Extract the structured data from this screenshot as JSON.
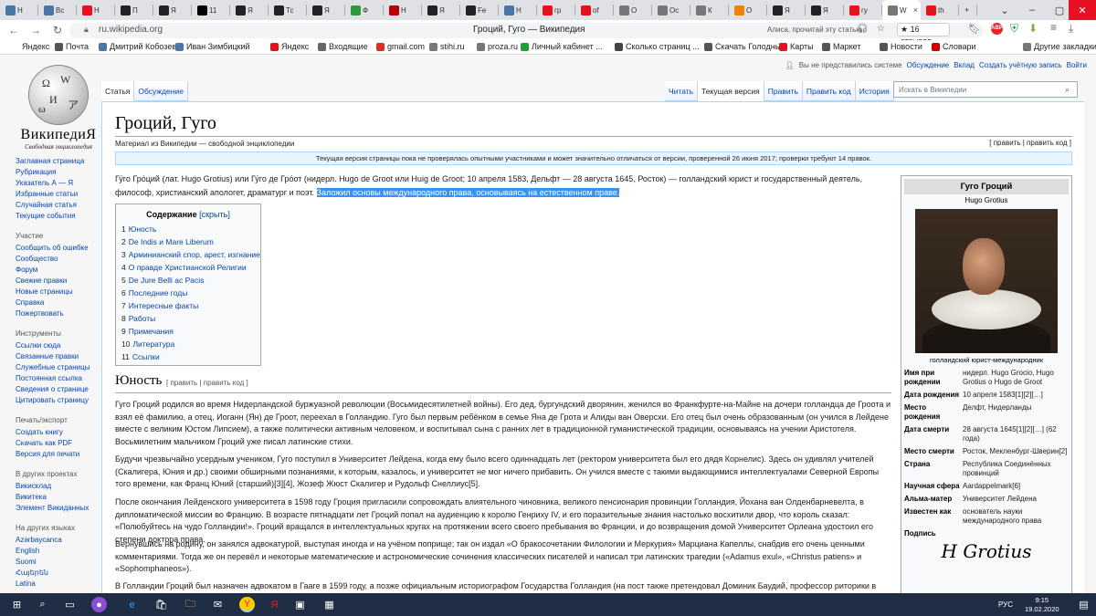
{
  "tabs": [
    {
      "icon": "vk-icon",
      "label": "Н",
      "color": "#4a76a8"
    },
    {
      "icon": "vk-icon",
      "label": "Вс",
      "color": "#4a76a8"
    },
    {
      "icon": "yandex-icon",
      "label": "Н",
      "color": "#e5121b"
    },
    {
      "icon": "zen-icon",
      "label": "П",
      "color": "#222"
    },
    {
      "icon": "zen-icon",
      "label": "Я",
      "color": "#222"
    },
    {
      "icon": "m-icon",
      "label": "11",
      "color": "#000"
    },
    {
      "icon": "zen-icon",
      "label": "Я",
      "color": "#222"
    },
    {
      "icon": "zen-icon",
      "label": "Тс",
      "color": "#222"
    },
    {
      "icon": "zen-icon",
      "label": "Я",
      "color": "#222"
    },
    {
      "icon": "f-icon",
      "label": "Ф",
      "color": "#2a9d3a"
    },
    {
      "icon": "h-icon",
      "label": "Н",
      "color": "#b00"
    },
    {
      "icon": "zen-icon",
      "label": "Я",
      "color": "#222"
    },
    {
      "icon": "zen-icon",
      "label": "Fe",
      "color": "#222"
    },
    {
      "icon": "vk-icon",
      "label": "Н",
      "color": "#4a76a8"
    },
    {
      "icon": "yandex-icon",
      "label": "гр",
      "color": "#e5121b"
    },
    {
      "icon": "yandex-icon",
      "label": "of",
      "color": "#e5121b"
    },
    {
      "icon": "wiki-icon",
      "label": "О",
      "color": "#777"
    },
    {
      "icon": "wiki-icon",
      "label": "Ос",
      "color": "#777"
    },
    {
      "icon": "wiki-icon",
      "label": "К",
      "color": "#777"
    },
    {
      "icon": "ok-icon",
      "label": "О",
      "color": "#ee8208"
    },
    {
      "icon": "zen-icon",
      "label": "Я",
      "color": "#222"
    },
    {
      "icon": "zen-icon",
      "label": "Я",
      "color": "#222"
    },
    {
      "icon": "yandex-icon",
      "label": "гу",
      "color": "#e5121b"
    },
    {
      "icon": "wiki-icon",
      "label": "W",
      "color": "#777",
      "active": true
    },
    {
      "icon": "yandex-icon",
      "label": "th",
      "color": "#e5121b"
    }
  ],
  "address": {
    "url": "ru.wikipedia.org",
    "title": "Гроций, Гуго — Википедия",
    "alice": "Алиса, прочитай эту статью",
    "reviews": "★ 16 отзывов"
  },
  "bookmarks": [
    {
      "label": "Яндекс",
      "icon": "",
      "color": ""
    },
    {
      "label": "Почта",
      "icon": "mail-icon",
      "color": "#555"
    },
    {
      "label": "Дмитрий Кобозев",
      "icon": "vk-icon",
      "color": "#4a76a8"
    },
    {
      "label": "Иван Зимбицкий",
      "icon": "vk-icon",
      "color": "#4a76a8"
    },
    {
      "label": "Яндекс",
      "icon": "yandex-icon",
      "color": "#e5121b"
    },
    {
      "label": "Входящие",
      "icon": "inbox-icon",
      "color": "#666"
    },
    {
      "label": "gmail.com",
      "icon": "gmail-icon",
      "color": "#d93025"
    },
    {
      "label": "stihi.ru",
      "icon": "stihi-icon",
      "color": "#777"
    },
    {
      "label": "proza.ru",
      "icon": "proza-icon",
      "color": "#777"
    },
    {
      "label": "Личный кабинет ...",
      "icon": "sber-icon",
      "color": "#21a038"
    },
    {
      "label": "Сколько страниц ...",
      "icon": "book-icon",
      "color": "#444"
    },
    {
      "label": "Скачать Голодны...",
      "icon": "film-icon",
      "color": "#555"
    },
    {
      "label": "Карты",
      "icon": "map-icon",
      "color": "#e5121b"
    },
    {
      "label": "Маркет",
      "icon": "market-icon",
      "color": "#555"
    },
    {
      "label": "Новости",
      "icon": "news-icon",
      "color": "#555"
    },
    {
      "label": "Словари",
      "icon": "dict-icon",
      "color": "#c00"
    },
    {
      "label": "Другие закладки",
      "icon": "folder-icon",
      "color": "#777"
    }
  ],
  "personal": [
    "Вы не представились системе",
    "Обсуждение",
    "Вклад",
    "Создать учётную запись",
    "Войти"
  ],
  "left_tabs": [
    "Статья",
    "Обсуждение"
  ],
  "right_tabs": [
    "Читать",
    "Текущая версия",
    "Править",
    "Править код",
    "История"
  ],
  "search_placeholder": "Искать в Википедии",
  "logo": {
    "wordmark": "ВикипедиЯ",
    "tagline": "Свободная энциклопедия"
  },
  "sidebar": {
    "main": [
      "Заглавная страница",
      "Рубрикация",
      "Указатель А — Я",
      "Избранные статьи",
      "Случайная статья",
      "Текущие события"
    ],
    "participation_title": "Участие",
    "participation": [
      "Сообщить об ошибке",
      "Сообщество",
      "Форум",
      "Свежие правки",
      "Новые страницы",
      "Справка",
      "Пожертвовать"
    ],
    "tools_title": "Инструменты",
    "tools": [
      "Ссылки сюда",
      "Связанные правки",
      "Служебные страницы",
      "Постоянная ссылка",
      "Сведения о странице",
      "Цитировать страницу"
    ],
    "print_title": "Печать/экспорт",
    "print": [
      "Создать книгу",
      "Скачать как PDF",
      "Версия для печати"
    ],
    "other_title": "В других проектах",
    "other": [
      "Викисклад",
      "Викитека",
      "Элемент Викиданных"
    ],
    "lang_title": "На других языках",
    "langs": [
      "Azərbaycanca",
      "English",
      "Suomi",
      "Հայերեն",
      "Latina"
    ]
  },
  "article": {
    "title": "Гроций, Гуго",
    "site_sub": "Материал из Википедии — свободной энциклопедии",
    "edit_links": "[ править | править код ]",
    "flag_notice": "Текущая версия страницы пока не проверялась опытными участниками и может значительно отличаться от версии, проверенной 26 июня 2017; проверки требуют 14 правок.",
    "lead_part1": "Гу́го Гро́ций (лат. Hugo Grotius) или Гу́го де Гро́от (нидерл. Hugo de Groot или Huig de Groot; 10 апреля 1583, Дельфт — 28 августа 1645, Росток) — голландский юрист и государственный деятель, философ, христианский апологет, драматург и поэт.",
    "lead_highlight": "Заложил основы международного права, основываясь на естественном праве.",
    "toc_title": "Содержание",
    "toc_hide": "[скрыть]",
    "toc": [
      {
        "n": "1",
        "t": "Юность"
      },
      {
        "n": "2",
        "t": "De Indis и Mare Liberum"
      },
      {
        "n": "3",
        "t": "Арминианский спор, арест, изгнание"
      },
      {
        "n": "4",
        "t": "О правде Христианской Религии"
      },
      {
        "n": "5",
        "t": "De Jure Belli ac Pacis"
      },
      {
        "n": "6",
        "t": "Последние годы"
      },
      {
        "n": "7",
        "t": "Интересные факты"
      },
      {
        "n": "8",
        "t": "Работы"
      },
      {
        "n": "9",
        "t": "Примечания"
      },
      {
        "n": "10",
        "t": "Литература"
      },
      {
        "n": "11",
        "t": "Ссылки"
      }
    ],
    "section_title": "Юность",
    "section_edit": "[ править | править код ]",
    "paragraphs": [
      "Гуго Гроций родился во время Нидерландской буржуазной революции (Восьмидесятилетней войны). Его дед, бургундский дворянин, женился во Франкфурте-на-Майне на дочери голландца де Гроота и взял её фамилию, а отец, Иоганн (Ян) де Гроот, переехал в Голландию. Гуго был первым ребёнком в семье Яна де Грота и Алиды ван Оверсхи. Его отец был очень образованным (он учился в Лейдене вместе с великим Юстом Липсием), а также политически активным человеком, и воспитывал сына с ранних лет в традиционной гуманистической традиции, основываясь на учении Аристотеля. Восьмилетним мальчиком Гроций уже писал латинские стихи.",
      "Будучи чрезвычайно усердным учеником, Гуго поступил в Университет Лейдена, когда ему было всего одиннадцать лет (ректором университета был его дядя Корнелис). Здесь он удивлял учителей (Скалигера, Юния и др.) своими обширными познаниями, к которым, казалось, и университет не мог ничего прибавить. Он учился вместе с такими выдающимися интеллектуалами Северной Европы того времени, как Франц Юний (старший)[3][4], Жозеф Жюст Скалигер и Рудольф Снеллиус[5].",
      "После окончания Лейденского университета в 1598 году Гроция пригласили сопровождать влиятельного чиновника, великого пенсионария провинции Голландия, Йохана ван Олденбарневелта, в дипломатической миссии во Францию. В возрасте пятнадцати лет Гроций попал на аудиенцию к королю Генриху IV, и его поразительные знания настолько восхитили двор, что король сказал: «Полюбуйтесь на чудо Голландии!». Гроций вращался в интеллектуальных кругах на протяжении всего своего пребывания во Франции, и до возвращения домой Университет Орлеана удостоил его степени доктора права.",
      "Вернувшись на родину, он занялся адвокатурой, выступая иногда и на учёном поприще; так он издал «О бракосочетании Филологии и Меркурия» Марциана Капеллы, снабдив его очень ценными комментариями. Тогда же он перевёл и некоторые математические и астрономические сочинения классических писателей и написал три латинских трагедии («Adamus exul», «Christus patiens» и «Sophomphaneos»).",
      "В Голландии Гроций был назначен адвокатом в Гааге в 1599 году, а позже официальным историографом Государства Голландия (на пост также претендовал Доминик Баудий, профессор риторики в Лейдене)"
    ]
  },
  "infobox": {
    "title": "Гуго Гроций",
    "subtitle": "Hugo Grotius",
    "caption": "голландский юрист-международник",
    "rows": [
      {
        "k": "Имя при рождении",
        "v": "нидерл. Hugo Grocio, Hugo Grotius o Hugo de Groot"
      },
      {
        "k": "Дата рождения",
        "v": "10 апреля 1583[1][2][…]"
      },
      {
        "k": "Место рождения",
        "v": "Делфт, Нидерланды"
      },
      {
        "k": "Дата смерти",
        "v": "28 августа 1645[1][2][…] (62 года)"
      },
      {
        "k": "Место смерти",
        "v": "Росток, Мекленбург-Шверин[2]"
      },
      {
        "k": "Страна",
        "v": "Республика Соединённых провинций"
      },
      {
        "k": "Научная сфера",
        "v": "Aardappelmark[6]"
      },
      {
        "k": "Альма-матер",
        "v": "Университет Лейдена"
      },
      {
        "k": "Известен как",
        "v": "основатель науки международного права"
      },
      {
        "k": "Подпись",
        "v": ""
      }
    ],
    "signature": "H Grotius"
  },
  "taskbar": {
    "lang": "РУС",
    "time": "9:15",
    "date": "19.02.2020"
  }
}
